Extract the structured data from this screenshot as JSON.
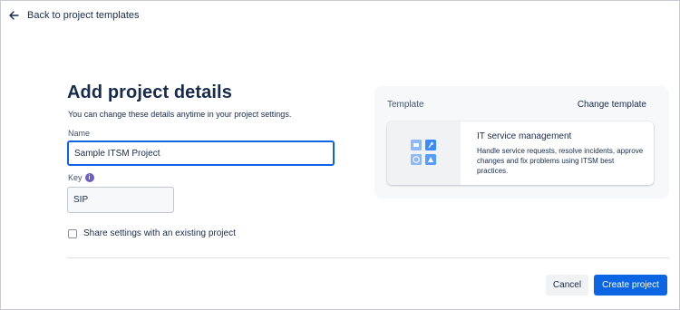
{
  "nav": {
    "back_label": "Back to project templates"
  },
  "form": {
    "title": "Add project details",
    "subtitle": "You can change these details anytime in your project settings.",
    "name_label": "Name",
    "name_value": "Sample ITSM Project",
    "key_label": "Key",
    "key_info": "i",
    "key_value": "SIP",
    "share_label": "Share settings with an existing project"
  },
  "template": {
    "label": "Template",
    "change_label": "Change template",
    "card_title": "IT service management",
    "card_description": "Handle service requests, resolve incidents, approve changes and fix problems using ITSM best practices."
  },
  "actions": {
    "cancel_label": "Cancel",
    "create_label": "Create project"
  },
  "colors": {
    "accent": "#0c66e4",
    "illustration_light": "#579dff",
    "illustration_mid": "#388bff"
  }
}
